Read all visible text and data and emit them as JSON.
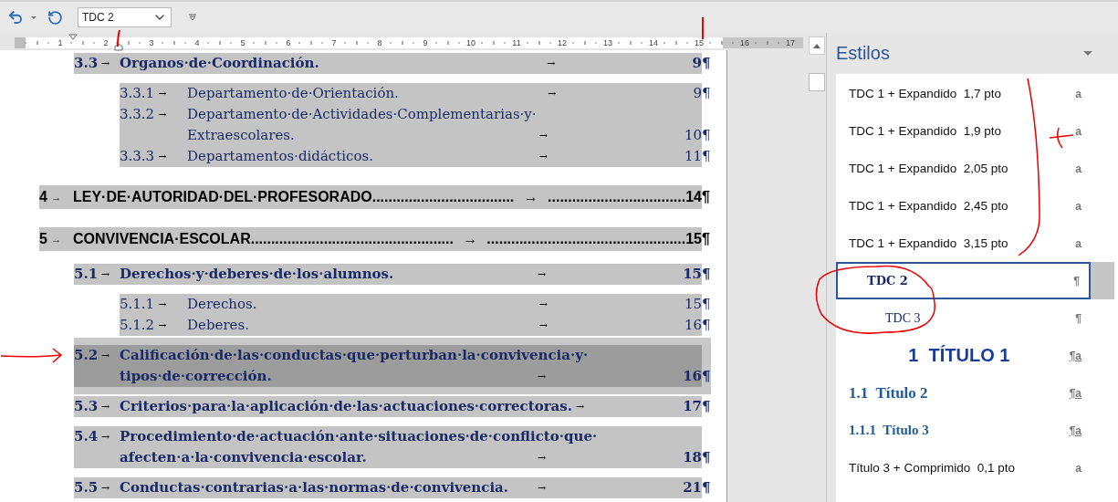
{
  "toolbar": {
    "style_box": {
      "value": "TDC 2"
    }
  },
  "ruler": {
    "labels": [
      "1",
      "2",
      "3",
      "4",
      "5",
      "6",
      "7",
      "8",
      "9",
      "10",
      "11",
      "12",
      "13",
      "14",
      "15",
      "16",
      "17"
    ]
  },
  "document": {
    "entries": [
      {
        "kind": "level2",
        "number": "3.3",
        "tab": "→",
        "lines": [
          "Organos·de·Coordinación."
        ],
        "leader": "→",
        "page": "9",
        "end": "¶",
        "selected": false
      },
      {
        "kind": "level3",
        "number": "3.3.1",
        "tab": "→",
        "lines": [
          "Departamento·de·Orientación."
        ],
        "leader": "→",
        "page": "9",
        "end": "¶",
        "selected": false
      },
      {
        "kind": "level3",
        "number": "3.3.2",
        "tab": "→",
        "lines": [
          "Departamento·de·Actividades·Complementarias·y·",
          "Extraescolares."
        ],
        "leader": "→",
        "page": "10",
        "end": "¶",
        "selected": false
      },
      {
        "kind": "level3",
        "number": "3.3.3",
        "tab": "→",
        "lines": [
          "Departamentos·didácticos."
        ],
        "leader": "→",
        "page": "11",
        "end": "¶",
        "selected": false
      },
      {
        "kind": "level1",
        "number": "4",
        "tab": "→",
        "lines": [
          "LEY·DE·AUTORIDAD·DEL·PROFESORADO."
        ],
        "leader_dots": [
          "..................................",
          "→",
          ".................................."
        ],
        "page": "14",
        "end": "¶",
        "selected": false
      },
      {
        "kind": "level1",
        "number": "5",
        "tab": "→",
        "lines": [
          "CONVIVENCIA·ESCOLAR."
        ],
        "leader_dots": [
          ".................................................",
          "→",
          "................................................."
        ],
        "page": "15",
        "end": "¶",
        "selected": false
      },
      {
        "kind": "level2",
        "number": "5.1",
        "tab": "→",
        "lines": [
          "Derechos·y·deberes·de·los·alumnos."
        ],
        "leader": "→",
        "page": "15",
        "end": "¶",
        "selected": false
      },
      {
        "kind": "level3",
        "number": "5.1.1",
        "tab": "→",
        "lines": [
          "Derechos."
        ],
        "leader": "→",
        "page": "15",
        "end": "¶",
        "selected": false
      },
      {
        "kind": "level3",
        "number": "5.1.2",
        "tab": "→",
        "lines": [
          "Deberes."
        ],
        "leader": "→",
        "page": "16",
        "end": "¶",
        "selected": false
      },
      {
        "kind": "level2",
        "number": "5.2",
        "tab": "→",
        "lines": [
          "Calificación·de·las·conductas·que·perturban·la·convivencia·y·",
          "tipos·de·corrección."
        ],
        "leader": "→",
        "page": "16",
        "end": "¶",
        "selected": true
      },
      {
        "kind": "level2",
        "number": "5.3",
        "tab": "→",
        "lines": [
          "Criterios·para·la·aplicación·de·las·actuaciones·correctoras."
        ],
        "leader": "→",
        "page": "17",
        "end": "¶",
        "selected": false
      },
      {
        "kind": "level2",
        "number": "5.4",
        "tab": "→",
        "lines": [
          "Procedimiento·de·actuación·ante·situaciones·de·conflicto·que·",
          "afecten·a·la·convivencia·escolar."
        ],
        "leader": "→",
        "page": "18",
        "end": "¶",
        "selected": false
      },
      {
        "kind": "level2",
        "number": "5.5",
        "tab": "→",
        "lines": [
          "Conductas·contrarias·a·las·normas·de·convivencia."
        ],
        "leader": "→",
        "page": "21",
        "end": "¶",
        "selected": false
      }
    ]
  },
  "styles_pane": {
    "title": "Estilos",
    "items": [
      {
        "kind": "plain",
        "label": "TDC 1 + Expandido  1,7 pto",
        "mark": "a",
        "selected": false
      },
      {
        "kind": "plain",
        "label": "TDC 1 + Expandido  1,9 pto",
        "mark": "a",
        "selected": false
      },
      {
        "kind": "plain",
        "label": "TDC 1 + Expandido  2,05 pto",
        "mark": "a",
        "selected": false
      },
      {
        "kind": "plain",
        "label": "TDC 1 + Expandido  2,45 pto",
        "mark": "a",
        "selected": false
      },
      {
        "kind": "plain",
        "label": "TDC 1 + Expandido  3,15 pto",
        "mark": "a",
        "selected": false
      },
      {
        "kind": "toc2",
        "label": "TDC 2",
        "mark": "¶",
        "selected": true
      },
      {
        "kind": "toc3",
        "label": "TDC 3",
        "mark": "¶",
        "selected": false
      },
      {
        "kind": "heading1",
        "label": "1  TÍTULO 1",
        "mark": "¶a",
        "selected": false
      },
      {
        "kind": "heading2",
        "label": "1.1  Título 2",
        "mark": "¶a",
        "selected": false
      },
      {
        "kind": "heading3",
        "label": "1.1.1  Título 3",
        "mark": "¶a",
        "selected": false
      },
      {
        "kind": "plain",
        "label": "Título 3 + Comprimido  0,1 pto",
        "mark": "a",
        "selected": false
      }
    ]
  }
}
